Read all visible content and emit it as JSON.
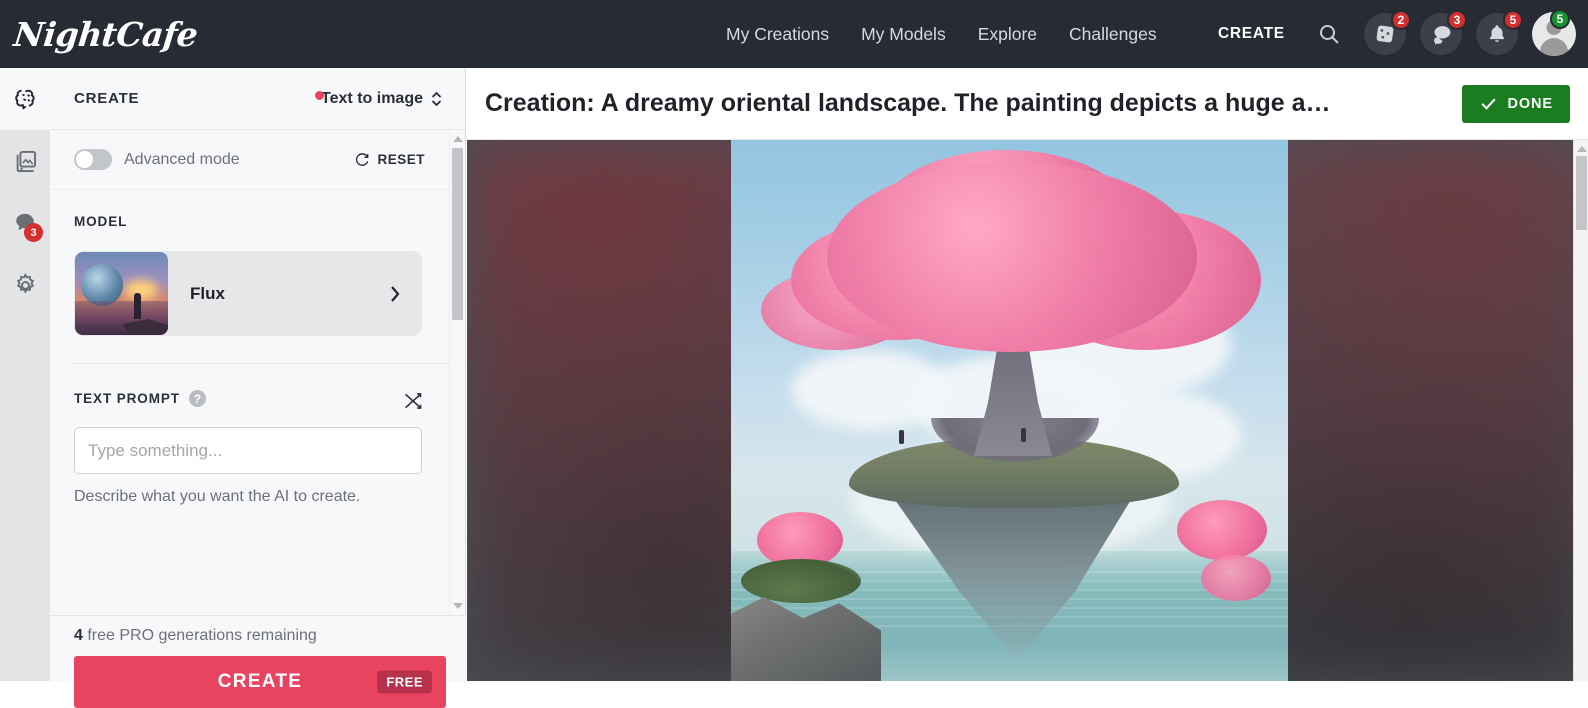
{
  "brand": {
    "name": "NightCafe"
  },
  "topnav": {
    "links": [
      {
        "label": "My Creations"
      },
      {
        "label": "My Models"
      },
      {
        "label": "Explore"
      },
      {
        "label": "Challenges"
      }
    ],
    "create_label": "CREATE",
    "icons": [
      {
        "name": "search-icon",
        "badge": ""
      },
      {
        "name": "dice-icon",
        "badge": "2"
      },
      {
        "name": "chat-icon",
        "badge": "3"
      },
      {
        "name": "bell-icon",
        "badge": "5"
      }
    ],
    "avatar_badge": "5"
  },
  "rail": {
    "items": [
      {
        "name": "brain-icon",
        "active": true,
        "badge": ""
      },
      {
        "name": "gallery-icon",
        "active": false,
        "badge": ""
      },
      {
        "name": "chat-icon",
        "active": false,
        "badge": "3"
      },
      {
        "name": "settings-gear-icon",
        "active": false,
        "badge": ""
      }
    ]
  },
  "panel": {
    "title": "CREATE",
    "mode_value": "Text to image",
    "advanced_mode_label": "Advanced mode",
    "advanced_mode_on": false,
    "reset_label": "RESET",
    "model": {
      "section_label": "MODEL",
      "name": "Flux"
    },
    "prompt": {
      "section_label": "TEXT PROMPT",
      "help_glyph": "?",
      "value": "",
      "placeholder": "Type something...",
      "hint": "Describe what you want the AI to create."
    },
    "footer": {
      "generations_count": "4",
      "generations_text": " free PRO generations remaining",
      "create_label": "CREATE",
      "free_badge": "FREE"
    }
  },
  "main": {
    "title": "Creation: A dreamy oriental landscape. The painting depicts a huge a…",
    "done_label": "DONE"
  },
  "colors": {
    "nav_bg": "#272b33",
    "accent_pink": "#e8445f",
    "done_green": "#1a7d1f",
    "badge_red": "#d32f2f",
    "badge_green": "#16922e",
    "panel_bg": "#f7f8fa"
  }
}
